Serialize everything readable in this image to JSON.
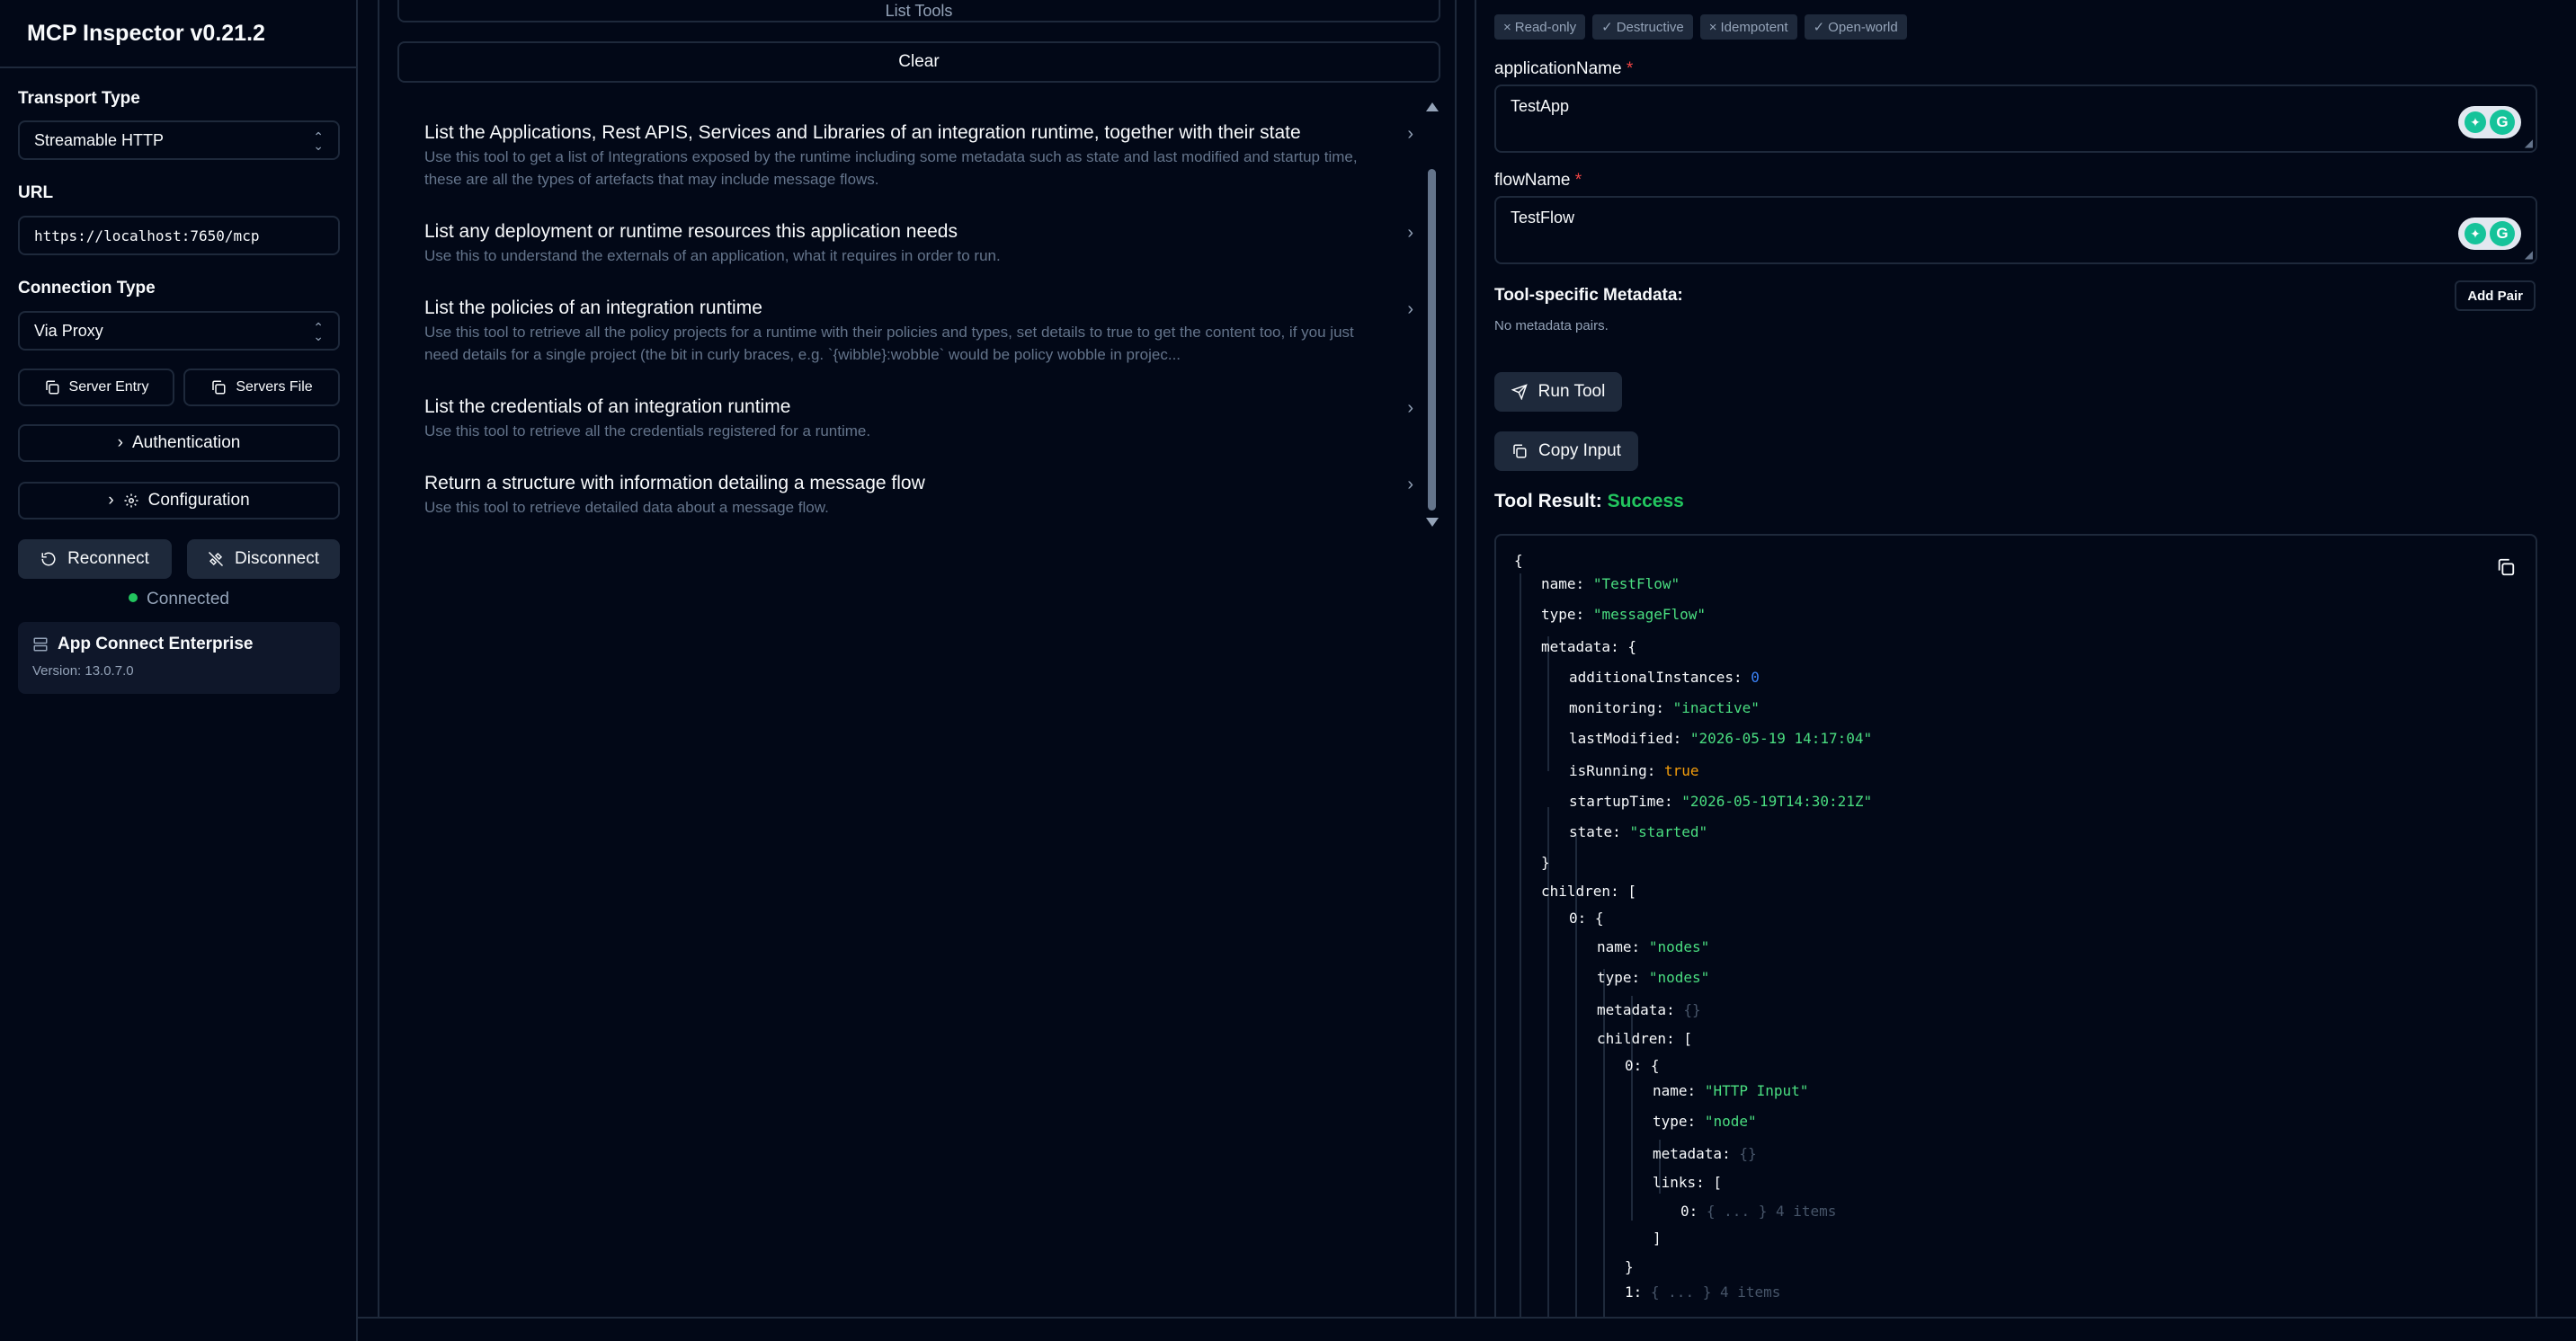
{
  "sidebar": {
    "title": "MCP Inspector v0.21.2",
    "transport_label": "Transport Type",
    "transport_value": "Streamable HTTP",
    "url_label": "URL",
    "url_value": "https://localhost:7650/mcp",
    "connection_label": "Connection Type",
    "connection_value": "Via Proxy",
    "server_entry": "Server Entry",
    "servers_file": "Servers File",
    "authentication": "Authentication",
    "configuration": "Configuration",
    "reconnect": "Reconnect",
    "disconnect": "Disconnect",
    "status": "Connected",
    "server_name": "App Connect Enterprise",
    "server_version": "Version: 13.0.7.0"
  },
  "middle": {
    "list_tools": "List Tools",
    "clear": "Clear",
    "tools": [
      {
        "name": "List the Applications, Rest APIS, Services and Libraries of an integration runtime, together with their state",
        "desc": "Use this tool to get a list of Integrations exposed by the runtime including some metadata such as state and last modified and startup time, these are all the types of artefacts that may include message flows."
      },
      {
        "name": "List any deployment or runtime resources this application needs",
        "desc": "Use this to understand the externals of an application, what it requires in order to run."
      },
      {
        "name": "List the policies of an integration runtime",
        "desc": "Use this tool to retrieve all the policy projects for a runtime with their policies and types, set details to true to get the content too, if you just need details for a single project (the bit in curly braces, e.g. `{wibble}:wobble` would be policy wobble in projec..."
      },
      {
        "name": "List the credentials of an integration runtime",
        "desc": "Use this tool to retrieve all the credentials registered for a runtime."
      },
      {
        "name": "Return a structure with information detailing a message flow",
        "desc": "Use this tool to retrieve detailed data about a message flow."
      }
    ]
  },
  "right": {
    "badges": [
      "Read-only",
      "Destructive",
      "Idempotent",
      "Open-world"
    ],
    "app_label": "applicationName",
    "app_value": "TestApp",
    "flow_label": "flowName",
    "flow_value": "TestFlow",
    "meta_label": "Tool-specific Metadata:",
    "meta_empty": "No metadata pairs.",
    "add_pair": "Add Pair",
    "run_tool": "Run Tool",
    "copy_input": "Copy Input",
    "result_label": "Tool Result:",
    "result_status": "Success"
  },
  "json_result": {
    "name": "\"TestFlow\"",
    "type": "\"messageFlow\"",
    "additionalInstances": "0",
    "monitoring": "\"inactive\"",
    "lastModified": "\"2026-05-19 14:17:04\"",
    "isRunning": "true",
    "startupTime": "\"2026-05-19T14:30:21Z\"",
    "state": "\"started\"",
    "child0_name": "\"nodes\"",
    "child0_type": "\"nodes\"",
    "node0_name": "\"HTTP Input\"",
    "node0_type": "\"node\"",
    "collapsed_obj": "{ ... }",
    "collapsed_count": "4 items",
    "empty_obj": "{}"
  }
}
